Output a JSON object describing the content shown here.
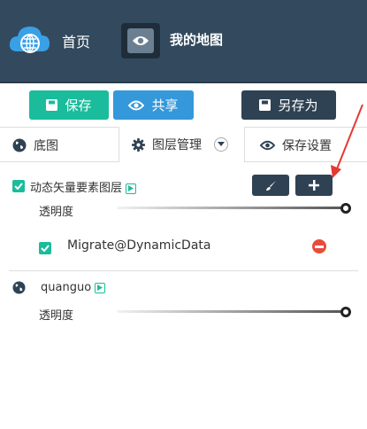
{
  "header": {
    "home_label": "首页",
    "map_title": "我的地图",
    "colors": {
      "bg": "#334a5e",
      "logo": "#3498db"
    }
  },
  "toolbar": {
    "save_label": "保存",
    "share_label": "共享",
    "save_as_label": "另存为"
  },
  "tabs": [
    {
      "label": "底图",
      "icon": "globe-icon"
    },
    {
      "label": "图层管理",
      "icon": "gear-icon",
      "active": true
    },
    {
      "label": "保存设置",
      "icon": "eye-icon"
    }
  ],
  "layers": [
    {
      "name": "动态矢量要素图层",
      "checked": true,
      "opacity_label": "透明度",
      "opacity": 1.0,
      "sublayers": [
        {
          "name": "Migrate@DynamicData",
          "checked": true
        }
      ]
    },
    {
      "name": "quanguo",
      "opacity_label": "透明度",
      "opacity": 1.0
    }
  ]
}
